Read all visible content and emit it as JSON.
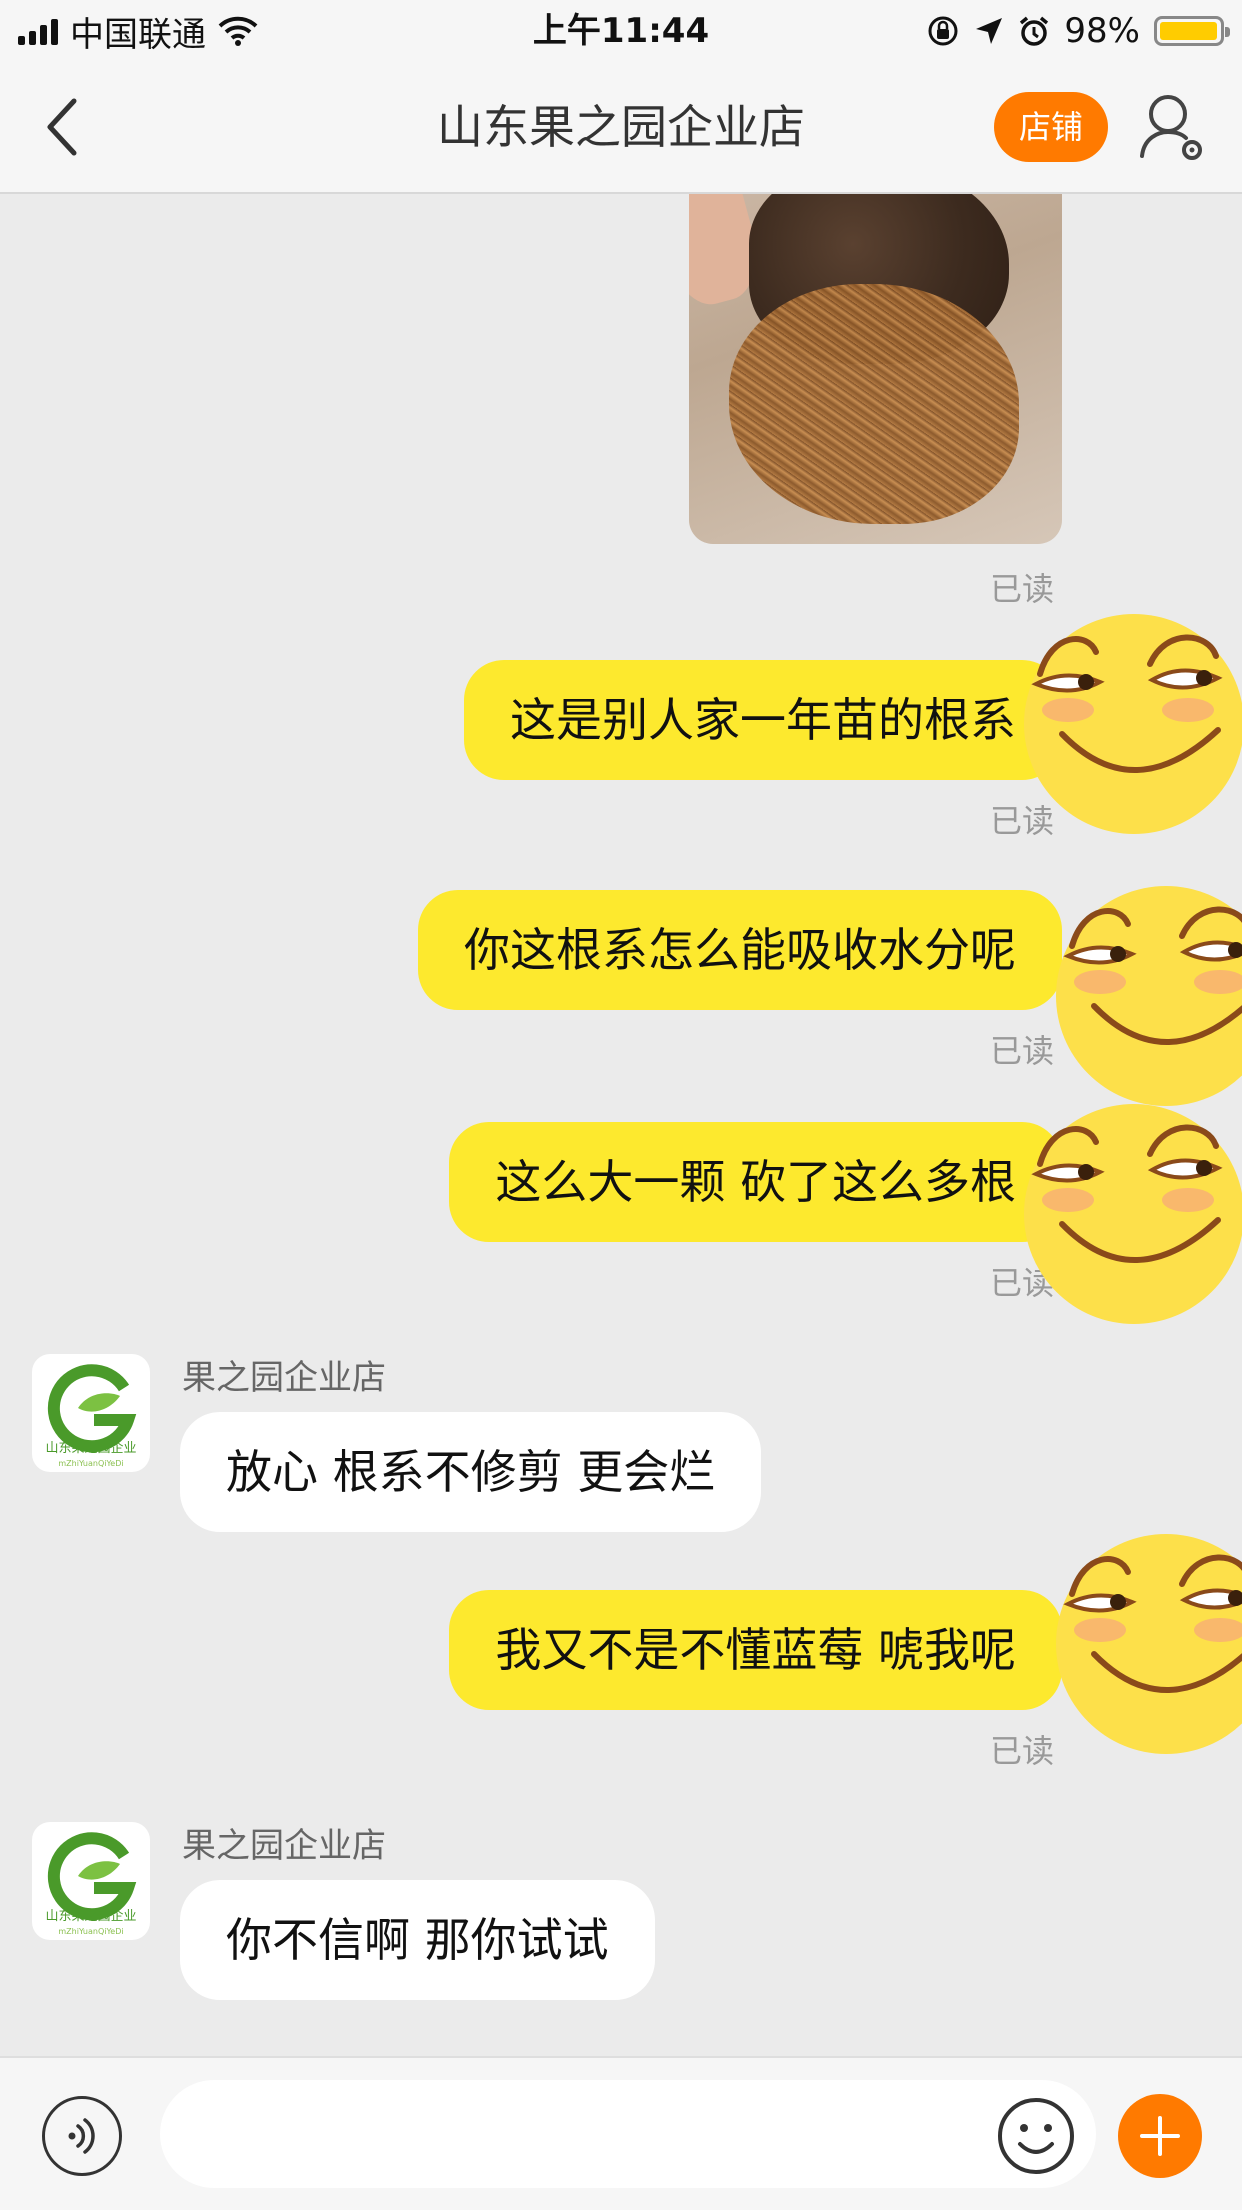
{
  "status_bar": {
    "carrier": "中国联通",
    "time": "上午11:44",
    "battery_percent": "98%",
    "battery_level": 0.98,
    "battery_color": "#ffcc00"
  },
  "nav": {
    "back_icon": "chevron-left-icon",
    "title": "山东果之园企业店",
    "shop_button": "店铺",
    "settings_icon": "user-settings-icon"
  },
  "messages": [
    {
      "type": "image",
      "from": "me",
      "read": "已读",
      "image": "soil-roots-photo"
    },
    {
      "type": "text",
      "from": "me",
      "text": "这是别人家一年苗的根系",
      "read": "已读"
    },
    {
      "type": "text",
      "from": "me",
      "text": "你这根系怎么能吸收水分呢",
      "read": "已读"
    },
    {
      "type": "text",
      "from": "me",
      "text": "这么大一颗 砍了这么多根",
      "read": "已读"
    },
    {
      "type": "text",
      "from": "them",
      "sender": "果之园企业店",
      "text": "放心 根系不修剪 更会烂"
    },
    {
      "type": "text",
      "from": "me",
      "text": "我又不是不懂蓝莓 唬我呢",
      "read": "已读"
    },
    {
      "type": "text",
      "from": "them",
      "sender": "果之园企业店",
      "text": "你不信啊 那你试试"
    }
  ],
  "avatar": {
    "logo_text": "山东果之园企业",
    "logo_subtext": "mZhiYuanQiYeDi",
    "brand_green": "#4a9a2a"
  },
  "input_bar": {
    "voice_icon": "voice-icon",
    "placeholder": "",
    "emoji_icon": "emoji-icon",
    "plus_icon": "plus-icon",
    "accent": "#ff7a00"
  }
}
